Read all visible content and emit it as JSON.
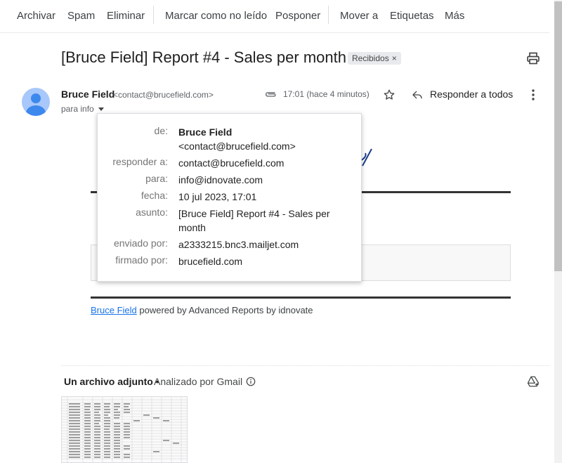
{
  "toolbar": {
    "archive": "Archivar",
    "spam": "Spam",
    "delete": "Eliminar",
    "mark_unread": "Marcar como no leído",
    "snooze": "Posponer",
    "move_to": "Mover a",
    "labels": "Etiquetas",
    "more": "Más"
  },
  "email": {
    "subject": "[Bruce Field] Report #4 - Sales per month",
    "label": "Recibidos",
    "label_close": "×",
    "sender_name": "Bruce Field",
    "sender_email": "<contact@brucefield.com>",
    "to_line": "para info",
    "time": "17:01 (hace 4 minutos)",
    "reply_all": "Responder a todos"
  },
  "details": {
    "from_key": "de:",
    "from_name": "Bruce Field",
    "from_email": "<contact@brucefield.com>",
    "reply_to_key": "responder a:",
    "reply_to_val": "contact@brucefield.com",
    "to_key": "para:",
    "to_val": "info@idnovate.com",
    "date_key": "fecha:",
    "date_val": "10 jul 2023, 17:01",
    "subject_key": "asunto:",
    "subject_val": "[Bruce Field] Report #4 - Sales per month",
    "mailed_by_key": "enviado por:",
    "mailed_by_val": "a2333215.bnc3.mailjet.com",
    "signed_by_key": "firmado por:",
    "signed_by_val": "brucefield.com"
  },
  "body": {
    "link": "Bruce Field",
    "powered": " powered by Advanced Reports by idnovate"
  },
  "attachments": {
    "title": "Un archivo adjunto",
    "dot": " • ",
    "scanned": "Analizado por Gmail"
  },
  "icons": {
    "print": "print-icon",
    "star": "star-icon",
    "reply": "reply-icon",
    "more": "more-vert-icon",
    "clip": "attachment-icon",
    "info": "info-icon",
    "drive": "add-to-drive-icon"
  }
}
